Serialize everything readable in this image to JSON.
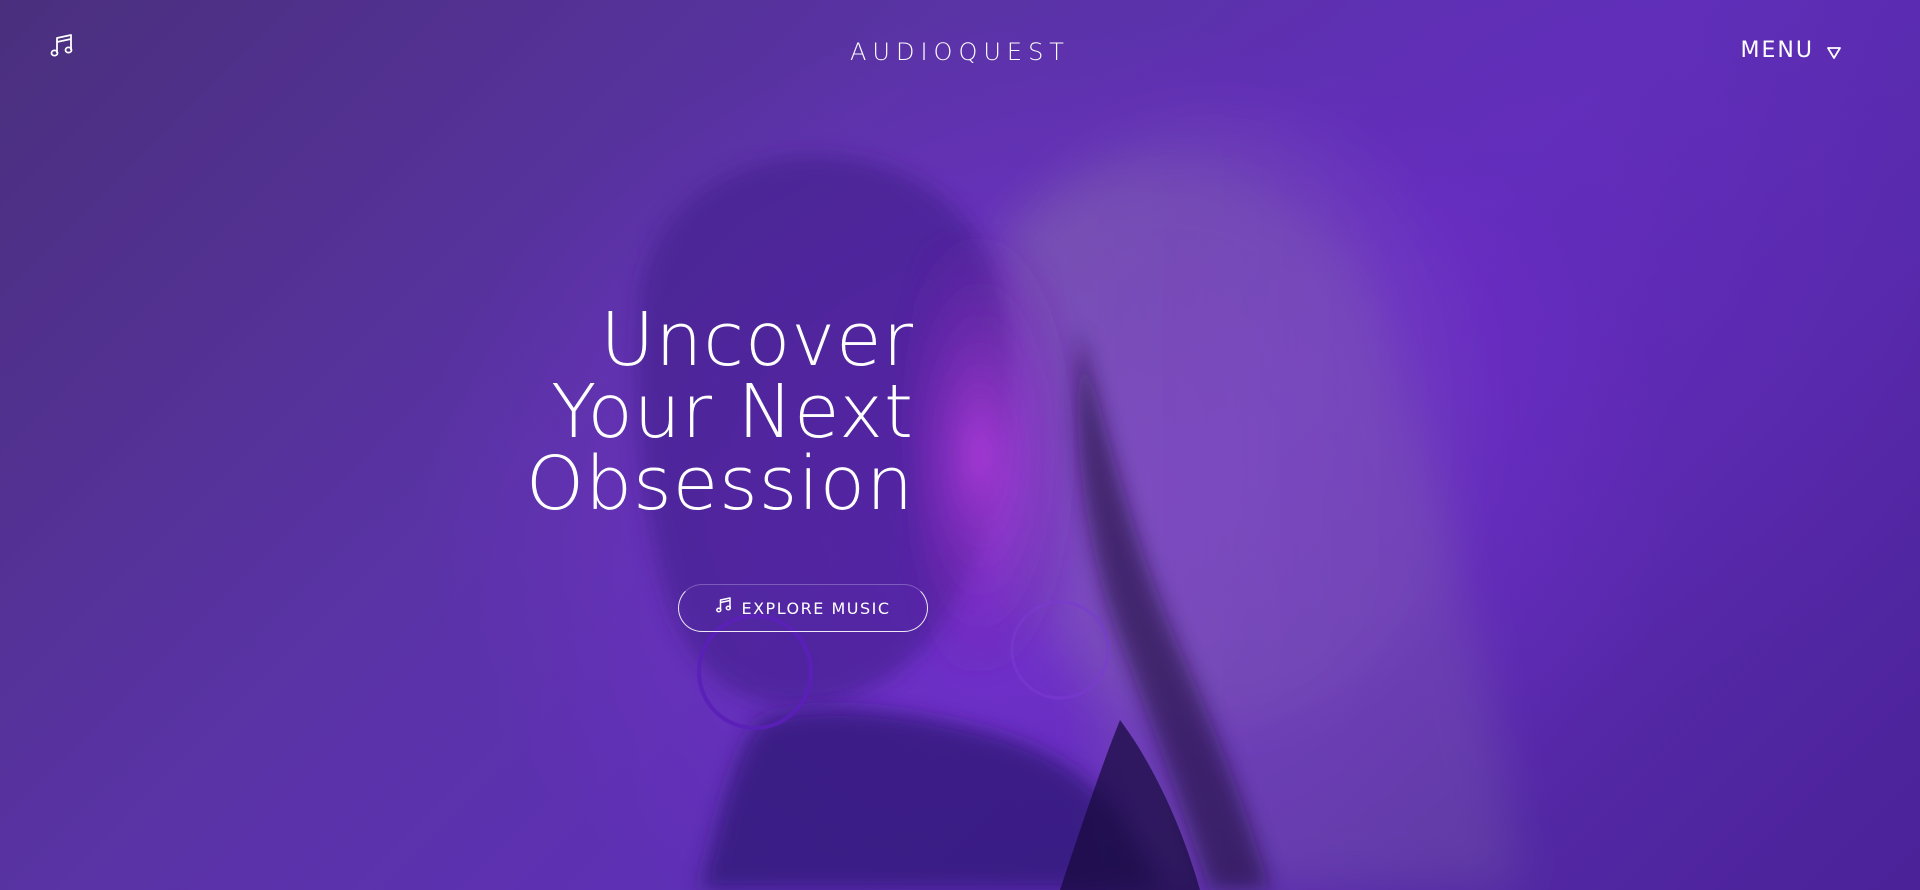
{
  "header": {
    "logo_icon": "music-note-icon",
    "brand": "AUDIOQUEST",
    "menu_label": "MENU",
    "menu_icon": "triangle-down-icon"
  },
  "hero": {
    "title_lines": [
      "Uncover",
      "Your Next",
      "Obsession"
    ],
    "cta_label": "EXPLORE MUSIC",
    "cta_icon": "music-note-icon"
  },
  "colors": {
    "background": "#5a33a6",
    "accent": "#b23bff",
    "text": "#ffffff"
  }
}
